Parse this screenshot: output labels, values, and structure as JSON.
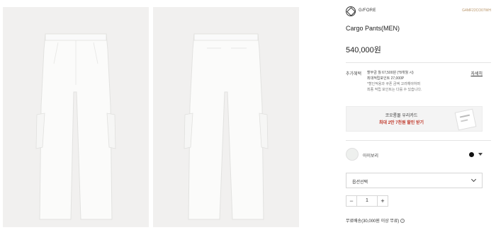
{
  "product": {
    "brand": "G/FORE",
    "code": "G4MF22CO07WH",
    "title": "Cargo Pants(MEN)",
    "price": "540,000원"
  },
  "benefits": {
    "label": "추가혜택",
    "line1": "할부금 월 67,500원 (*8개월 시)",
    "line2": "최대적립포인트 27,000P",
    "line3": "*할인적용과 쿠폰 금액 고려해야하며",
    "line4": "최종 적립 포인트는 다를 수 있습니다.",
    "detail_link": "자세히"
  },
  "coupon": {
    "line1": "코오롱몰 우리카드",
    "line2": "최대 2만 7천원 할인 받기"
  },
  "color": {
    "name": "아이보리",
    "swatch_color": "#eef0ee",
    "dot_color": "#111111"
  },
  "option_select": {
    "label": "옵션선택"
  },
  "quantity": {
    "minus": "−",
    "value": "1",
    "plus": "+"
  },
  "shipping": {
    "text": "무료배송(30,000원 이상 무료)",
    "icon": "info-icon"
  }
}
